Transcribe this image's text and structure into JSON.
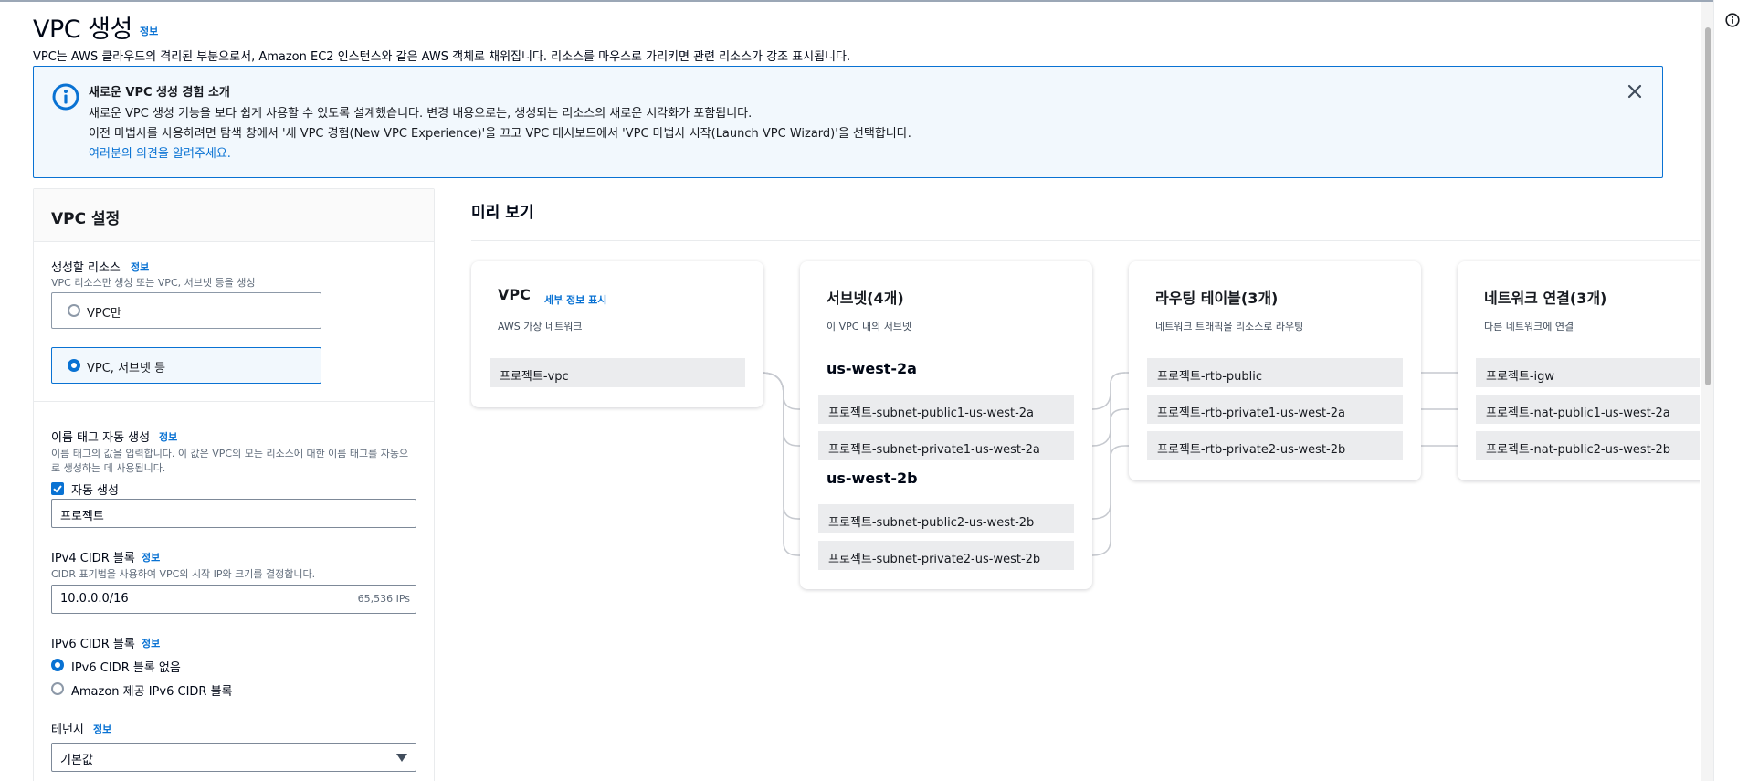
{
  "header": {
    "title": "VPC 생성",
    "info": "정보",
    "description": "VPC는 AWS 클라우드의 격리된 부분으로서, Amazon EC2 인스턴스와 같은 AWS 객체로 채워집니다. 리소스를 마우스로 가리키면 관련 리소스가 강조 표시됩니다."
  },
  "banner": {
    "title": "새로운 VPC 생성 경험 소개",
    "line1": "새로운 VPC 생성 기능을 보다 쉽게 사용할 수 있도록 설계했습니다. 변경 내용으로는, 생성되는 리소스의 새로운 시각화가 포함됩니다.",
    "line2": "이전 마법사를 사용하려면 탐색 창에서 '새 VPC 경험(New VPC Experience)'을 끄고 VPC 대시보드에서 'VPC 마법사 시작(Launch VPC Wizard)'을 선택합니다.",
    "feedback_link": "여러분의 의견을 알려주세요.",
    "info_icon": "info-circle-icon",
    "close_icon": "close-icon"
  },
  "settings": {
    "title": "VPC 설정",
    "resources": {
      "label": "생성할 리소스",
      "info": "정보",
      "description": "VPC 리소스만 생성 또는 VPC, 서브넷 등을 생성",
      "options": [
        "VPC만",
        "VPC, 서브넷 등"
      ],
      "selected": "VPC, 서브넷 등"
    },
    "name_tag": {
      "label": "이름 태그 자동 생성",
      "info": "정보",
      "description_line1": "이름 태그의 값을 입력합니다. 이 값은 VPC의 모든 리소스에 대한 이름 태그를 자동으",
      "description_line2": "로 생성하는 데 사용됩니다.",
      "checkbox_label": "자동 생성",
      "checked": true,
      "value": "프로젝트"
    },
    "ipv4": {
      "label": "IPv4 CIDR 블록",
      "info": "정보",
      "description": "CIDR 표기법을 사용하여 VPC의 시작 IP와 크기를 결정합니다.",
      "value": "10.0.0.0/16",
      "ip_count": "65,536 IPs"
    },
    "ipv6": {
      "label": "IPv6 CIDR 블록",
      "info": "정보",
      "options": [
        "IPv6 CIDR 블록 없음",
        "Amazon 제공 IPv6 CIDR 블록"
      ],
      "selected": "IPv6 CIDR 블록 없음"
    },
    "tenancy": {
      "label": "테넌시",
      "info": "정보",
      "value": "기본값"
    }
  },
  "preview": {
    "title": "미리 보기",
    "vpc_card": {
      "title": "VPC",
      "detail_link": "세부 정보 표시",
      "subtitle": "AWS 가상 네트워크",
      "items": [
        "프로젝트-vpc"
      ]
    },
    "subnet_card": {
      "title": "서브넷(4개)",
      "subtitle": "이 VPC 내의 서브넷",
      "groups": [
        {
          "az": "us-west-2a",
          "items": [
            "프로젝트-subnet-public1-us-west-2a",
            "프로젝트-subnet-private1-us-west-2a"
          ]
        },
        {
          "az": "us-west-2b",
          "items": [
            "프로젝트-subnet-public2-us-west-2b",
            "프로젝트-subnet-private2-us-west-2b"
          ]
        }
      ]
    },
    "route_card": {
      "title": "라우팅 테이블(3개)",
      "subtitle": "네트워크 트래픽을 리소스로 라우팅",
      "items": [
        "프로젝트-rtb-public",
        "프로젝트-rtb-private1-us-west-2a",
        "프로젝트-rtb-private2-us-west-2b"
      ]
    },
    "network_card": {
      "title": "네트워크 연결(3개)",
      "subtitle": "다른 네트워크에 연결",
      "items": [
        "프로젝트-igw",
        "프로젝트-nat-public1-us-west-2a",
        "프로젝트-nat-public2-us-west-2b"
      ]
    }
  },
  "right_rail": {
    "icon": "info-circle-icon"
  }
}
